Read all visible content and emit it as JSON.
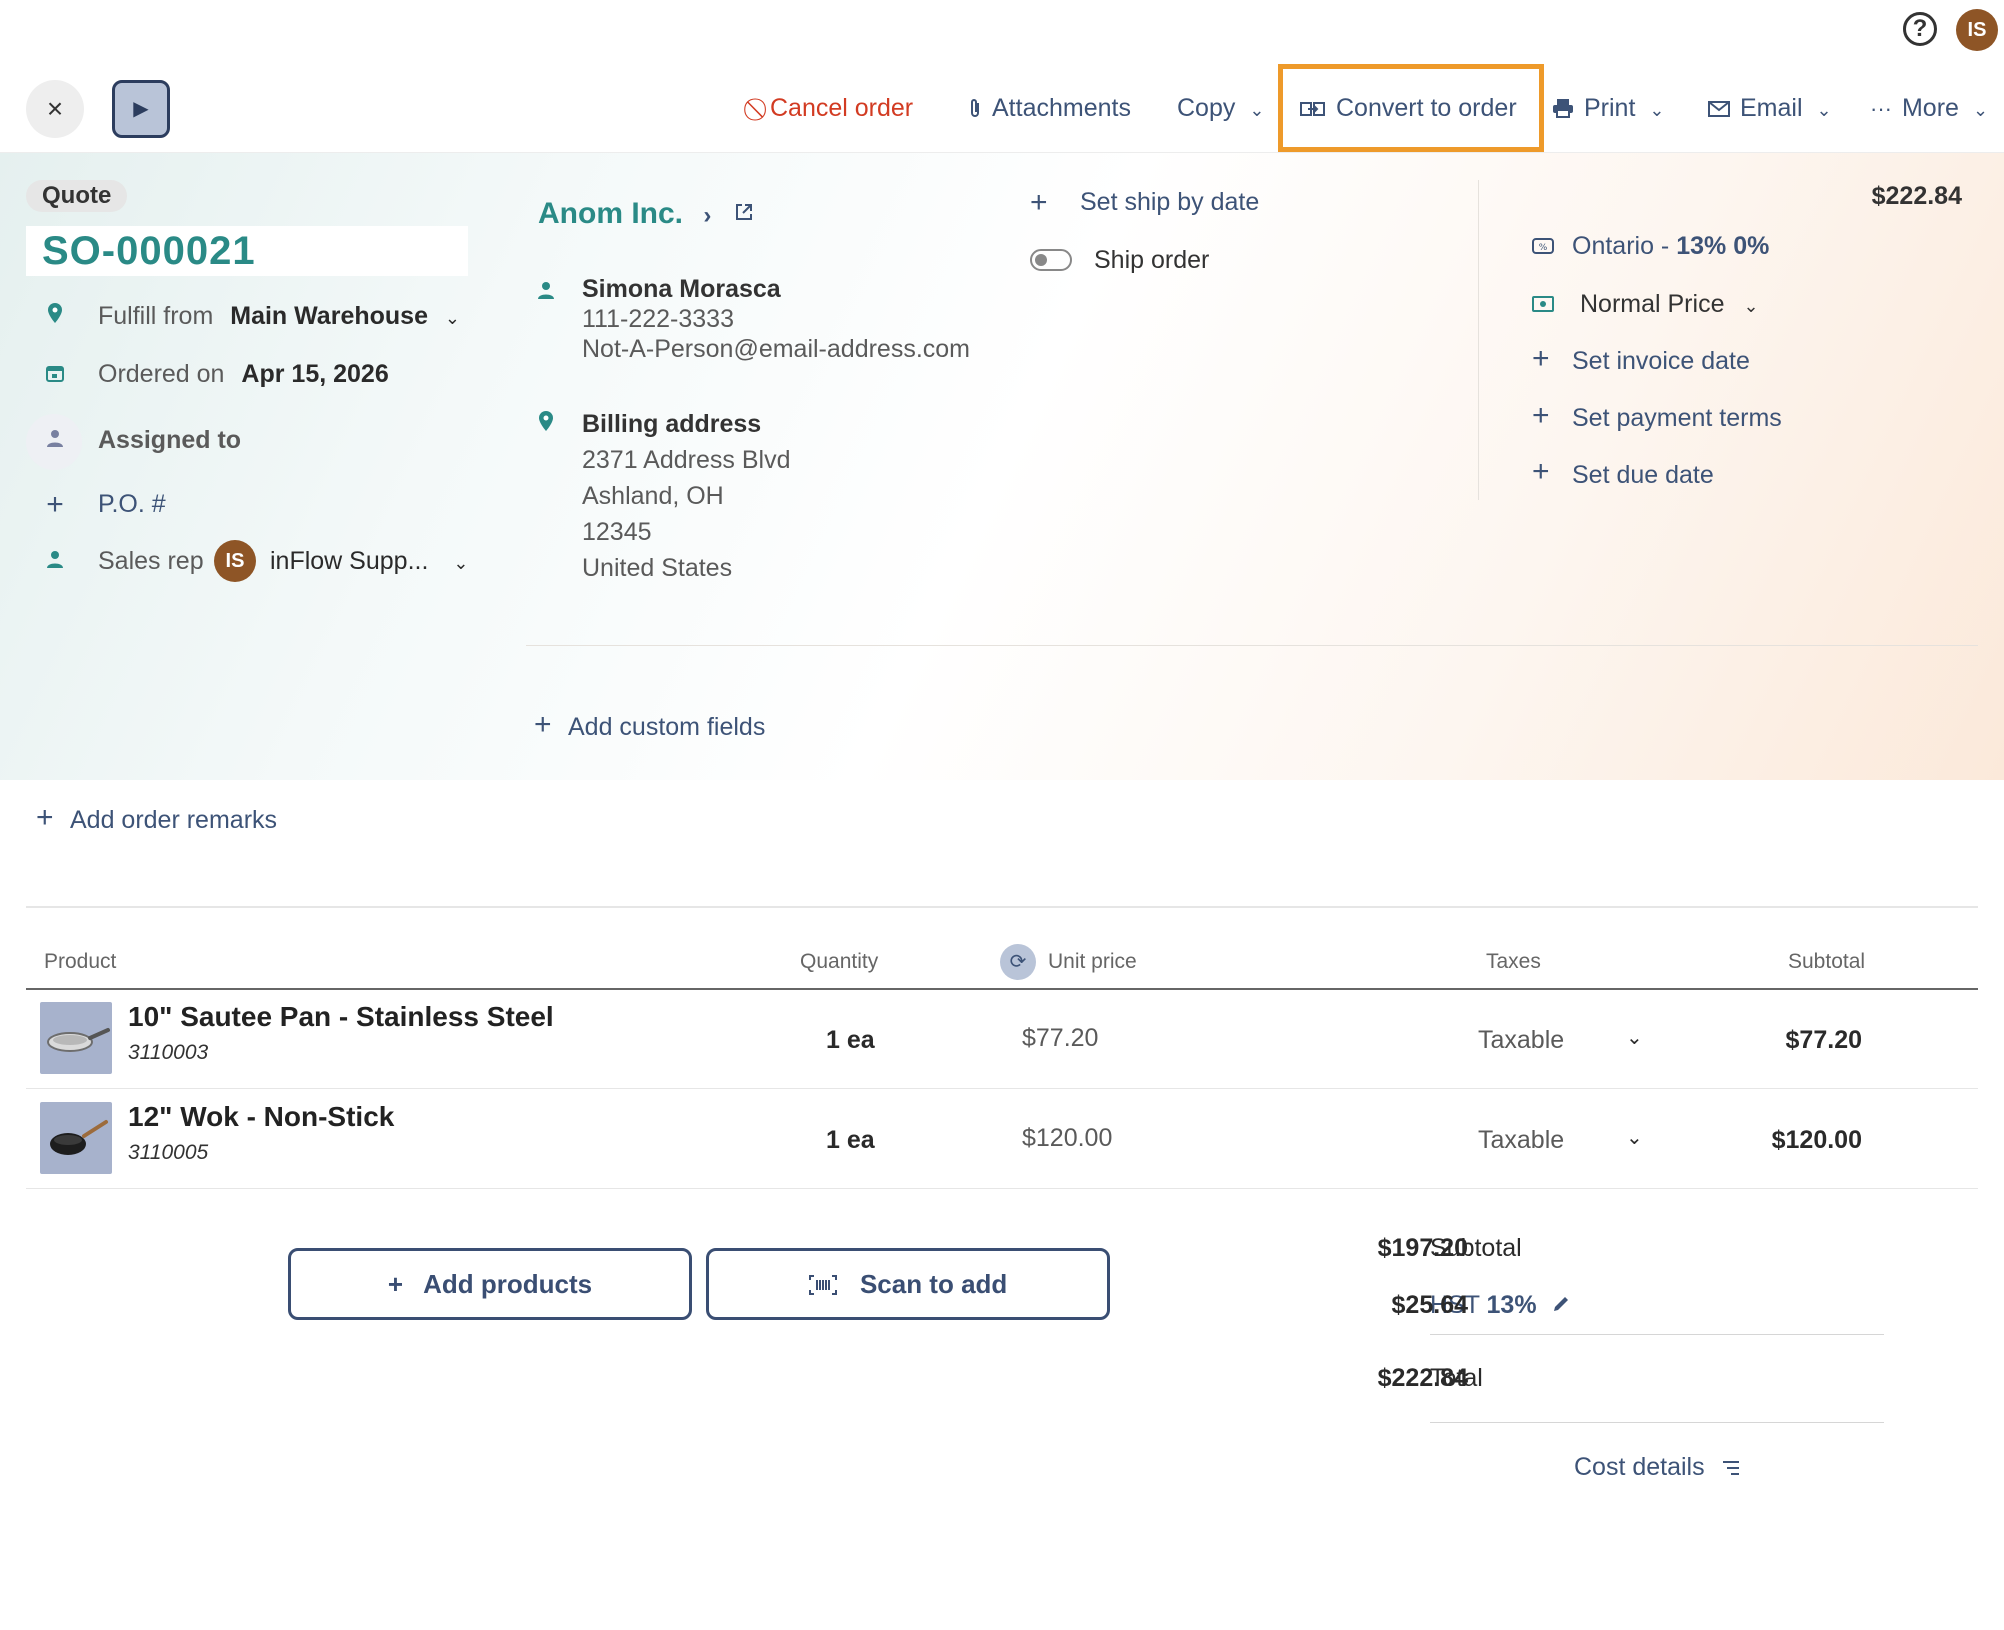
{
  "topbar": {
    "help_icon": "?",
    "user_initials": "IS"
  },
  "toolbar": {
    "close_icon": "×",
    "play_icon": "▶",
    "cancel_label": "Cancel order",
    "attachments_label": "Attachments",
    "copy_label": "Copy",
    "convert_label": "Convert to order",
    "print_label": "Print",
    "email_label": "Email",
    "more_label": "More",
    "more_icon": "···",
    "cancel_color": "#d23b22",
    "highlight_color": "#ee9a2a"
  },
  "order": {
    "status_badge": "Quote",
    "number": "SO-000021",
    "fulfill_label": "Fulfill from",
    "fulfill_value": "Main Warehouse",
    "ordered_label": "Ordered on",
    "ordered_value": "Apr 15, 2026",
    "assigned_label": "Assigned to",
    "po_label": "P.O. #",
    "sales_rep_label": "Sales rep",
    "sales_rep_initials": "IS",
    "sales_rep_value": "inFlow Supp..."
  },
  "customer": {
    "name": "Anom Inc.",
    "contact_name": "Simona Morasca",
    "phone": "111-222-3333",
    "email": "Not-A-Person@email-address.com",
    "billing_label": "Billing address",
    "address_line1": "2371 Address Blvd",
    "address_line2": "Ashland, OH",
    "address_line3": "12345",
    "address_line4": "United States"
  },
  "shipping": {
    "set_ship_by_label": "Set ship by date",
    "ship_order_label": "Ship order"
  },
  "summary": {
    "total_top": "$222.84",
    "tax_region": "Ontario -",
    "tax_rates": "13% 0%",
    "pricing_scheme": "Normal Price",
    "set_invoice_date": "Set invoice date",
    "set_payment_terms": "Set payment terms",
    "set_due_date": "Set due date"
  },
  "custom_fields_label": "Add custom fields",
  "remarks_label": "Add order remarks",
  "table": {
    "headers": {
      "product": "Product",
      "quantity": "Quantity",
      "unit_price": "Unit price",
      "taxes": "Taxes",
      "subtotal": "Subtotal"
    },
    "rows": [
      {
        "name": "10\" Sautee Pan - Stainless Steel",
        "sku": "3110003",
        "quantity": "1 ea",
        "unit_price": "$77.20",
        "taxes": "Taxable",
        "subtotal": "$77.20"
      },
      {
        "name": "12\" Wok - Non-Stick",
        "sku": "3110005",
        "quantity": "1 ea",
        "unit_price": "$120.00",
        "taxes": "Taxable",
        "subtotal": "$120.00"
      }
    ]
  },
  "actions": {
    "add_products": "Add products",
    "scan_to_add": "Scan to add"
  },
  "totals": {
    "subtotal_label": "Subtotal",
    "subtotal_value": "$197.20",
    "tax_label": "HST",
    "tax_rate": "13%",
    "tax_value": "$25.64",
    "total_label": "Total",
    "total_value": "$222.84",
    "cost_details_label": "Cost details"
  }
}
